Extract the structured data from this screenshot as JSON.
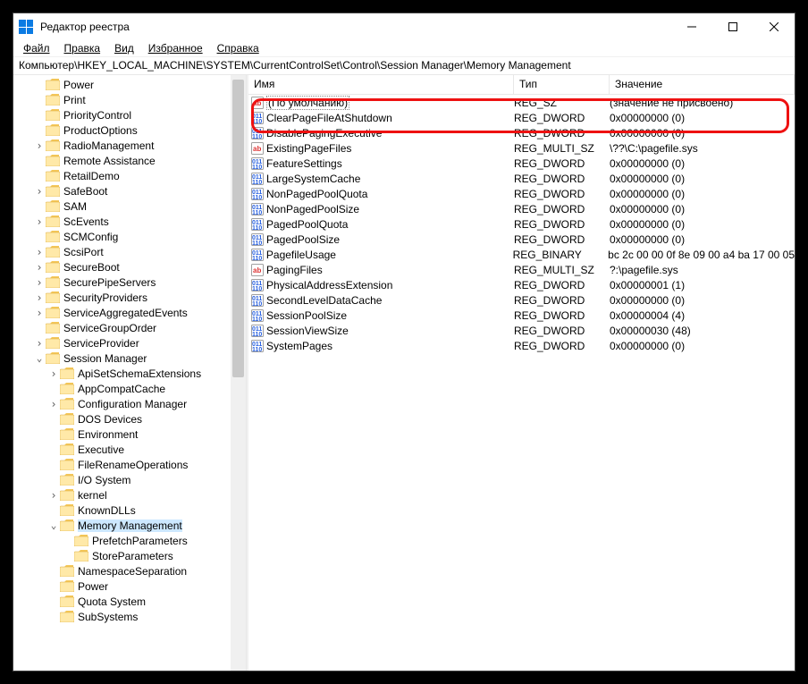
{
  "window": {
    "title": "Редактор реестра"
  },
  "menu": {
    "items": [
      {
        "label": "Файл",
        "u": 0
      },
      {
        "label": "Правка",
        "u": 0
      },
      {
        "label": "Вид",
        "u": 0
      },
      {
        "label": "Избранное",
        "u": 0
      },
      {
        "label": "Справка",
        "u": 0
      }
    ]
  },
  "address": "Компьютер\\HKEY_LOCAL_MACHINE\\SYSTEM\\CurrentControlSet\\Control\\Session Manager\\Memory Management",
  "tree": [
    {
      "d": 1,
      "label": "Power",
      "tw": ""
    },
    {
      "d": 1,
      "label": "Print",
      "tw": ""
    },
    {
      "d": 1,
      "label": "PriorityControl",
      "tw": ""
    },
    {
      "d": 1,
      "label": "ProductOptions",
      "tw": ""
    },
    {
      "d": 1,
      "label": "RadioManagement",
      "tw": "col"
    },
    {
      "d": 1,
      "label": "Remote Assistance",
      "tw": ""
    },
    {
      "d": 1,
      "label": "RetailDemo",
      "tw": ""
    },
    {
      "d": 1,
      "label": "SafeBoot",
      "tw": "col"
    },
    {
      "d": 1,
      "label": "SAM",
      "tw": ""
    },
    {
      "d": 1,
      "label": "ScEvents",
      "tw": "col"
    },
    {
      "d": 1,
      "label": "SCMConfig",
      "tw": ""
    },
    {
      "d": 1,
      "label": "ScsiPort",
      "tw": "col"
    },
    {
      "d": 1,
      "label": "SecureBoot",
      "tw": "col"
    },
    {
      "d": 1,
      "label": "SecurePipeServers",
      "tw": "col"
    },
    {
      "d": 1,
      "label": "SecurityProviders",
      "tw": "col"
    },
    {
      "d": 1,
      "label": "ServiceAggregatedEvents",
      "tw": "col"
    },
    {
      "d": 1,
      "label": "ServiceGroupOrder",
      "tw": ""
    },
    {
      "d": 1,
      "label": "ServiceProvider",
      "tw": "col"
    },
    {
      "d": 1,
      "label": "Session Manager",
      "tw": "exp"
    },
    {
      "d": 2,
      "label": "ApiSetSchemaExtensions",
      "tw": "col"
    },
    {
      "d": 2,
      "label": "AppCompatCache",
      "tw": ""
    },
    {
      "d": 2,
      "label": "Configuration Manager",
      "tw": "col"
    },
    {
      "d": 2,
      "label": "DOS Devices",
      "tw": ""
    },
    {
      "d": 2,
      "label": "Environment",
      "tw": ""
    },
    {
      "d": 2,
      "label": "Executive",
      "tw": ""
    },
    {
      "d": 2,
      "label": "FileRenameOperations",
      "tw": ""
    },
    {
      "d": 2,
      "label": "I/O System",
      "tw": ""
    },
    {
      "d": 2,
      "label": "kernel",
      "tw": "col"
    },
    {
      "d": 2,
      "label": "KnownDLLs",
      "tw": ""
    },
    {
      "d": 2,
      "label": "Memory Management",
      "tw": "exp",
      "selected": true,
      "open": true
    },
    {
      "d": 3,
      "label": "PrefetchParameters",
      "tw": ""
    },
    {
      "d": 3,
      "label": "StoreParameters",
      "tw": ""
    },
    {
      "d": 2,
      "label": "NamespaceSeparation",
      "tw": ""
    },
    {
      "d": 2,
      "label": "Power",
      "tw": ""
    },
    {
      "d": 2,
      "label": "Quota System",
      "tw": ""
    },
    {
      "d": 2,
      "label": "SubSystems",
      "tw": ""
    }
  ],
  "columns": {
    "name": "Имя",
    "type": "Тип",
    "value": "Значение"
  },
  "values": [
    {
      "icon": "str",
      "name": "(По умолчанию)",
      "type": "REG_SZ",
      "value": "(значение не присвоено)",
      "default": true
    },
    {
      "icon": "bin",
      "name": "ClearPageFileAtShutdown",
      "type": "REG_DWORD",
      "value": "0x00000000 (0)"
    },
    {
      "icon": "bin",
      "name": "DisablePagingExecutive",
      "type": "REG_DWORD",
      "value": "0x00000000 (0)"
    },
    {
      "icon": "str",
      "name": "ExistingPageFiles",
      "type": "REG_MULTI_SZ",
      "value": "\\??\\C:\\pagefile.sys"
    },
    {
      "icon": "bin",
      "name": "FeatureSettings",
      "type": "REG_DWORD",
      "value": "0x00000000 (0)"
    },
    {
      "icon": "bin",
      "name": "LargeSystemCache",
      "type": "REG_DWORD",
      "value": "0x00000000 (0)"
    },
    {
      "icon": "bin",
      "name": "NonPagedPoolQuota",
      "type": "REG_DWORD",
      "value": "0x00000000 (0)"
    },
    {
      "icon": "bin",
      "name": "NonPagedPoolSize",
      "type": "REG_DWORD",
      "value": "0x00000000 (0)"
    },
    {
      "icon": "bin",
      "name": "PagedPoolQuota",
      "type": "REG_DWORD",
      "value": "0x00000000 (0)"
    },
    {
      "icon": "bin",
      "name": "PagedPoolSize",
      "type": "REG_DWORD",
      "value": "0x00000000 (0)"
    },
    {
      "icon": "bin",
      "name": "PagefileUsage",
      "type": "REG_BINARY",
      "value": "bc 2c 00 00 0f 8e 09 00 a4 ba 17 00 05"
    },
    {
      "icon": "str",
      "name": "PagingFiles",
      "type": "REG_MULTI_SZ",
      "value": "?:\\pagefile.sys"
    },
    {
      "icon": "bin",
      "name": "PhysicalAddressExtension",
      "type": "REG_DWORD",
      "value": "0x00000001 (1)"
    },
    {
      "icon": "bin",
      "name": "SecondLevelDataCache",
      "type": "REG_DWORD",
      "value": "0x00000000 (0)"
    },
    {
      "icon": "bin",
      "name": "SessionPoolSize",
      "type": "REG_DWORD",
      "value": "0x00000004 (4)"
    },
    {
      "icon": "bin",
      "name": "SessionViewSize",
      "type": "REG_DWORD",
      "value": "0x00000030 (48)"
    },
    {
      "icon": "bin",
      "name": "SystemPages",
      "type": "REG_DWORD",
      "value": "0x00000000 (0)"
    }
  ],
  "highlightIndex": 1
}
